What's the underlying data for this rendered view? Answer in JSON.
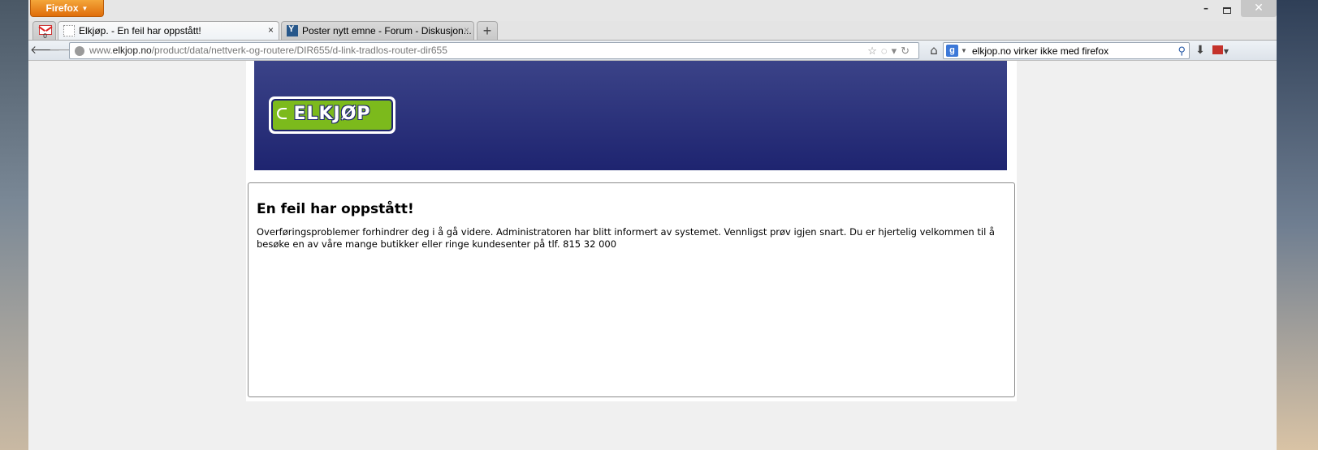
{
  "browser": {
    "menu_button_label": "Firefox",
    "window_controls": {
      "minimize": "–",
      "close": "✕"
    }
  },
  "tabs": [
    {
      "type": "app-tab",
      "icon": "gmail-icon",
      "badge": "0"
    },
    {
      "title": "Elkjøp. - En feil har oppstått!",
      "icon": "blank-page-icon",
      "active": true,
      "close": "×"
    },
    {
      "title": "Poster nytt emne - Forum - Diskusjon...",
      "icon": "forum-favicon",
      "active": false,
      "close": "×"
    }
  ],
  "new_tab_label": "+",
  "navbar": {
    "back": "🡐",
    "forward": "🡒",
    "url_prefix": "www.",
    "url_domain": "elkjop.no",
    "url_path": "/product/data/nettverk-og-routere/DIR655/d-link-tradlos-router-dir655",
    "url_icons": "☆◌▾↻",
    "home": "⌂",
    "search_engine_icon": "g",
    "search_value": "elkjop.no virker ikke med firefox",
    "search_go": "⚲",
    "download": "⬇"
  },
  "page": {
    "logo_text": "ELKJØP",
    "error_title": "En feil har oppstått!",
    "error_message": "Overføringsproblemer forhindrer deg i å gå videre. Administratoren har blitt informert av systemet. Vennligst prøv igjen snart. Du er hjertelig velkommen til å besøke en av våre mange butikker eller ringe kundesenter på tlf. 815 32 000"
  },
  "colors": {
    "banner_top": "#3b4388",
    "banner_bottom": "#1e2470",
    "logo_green": "#7cba1c",
    "firefox_orange": "#e06d0a"
  }
}
